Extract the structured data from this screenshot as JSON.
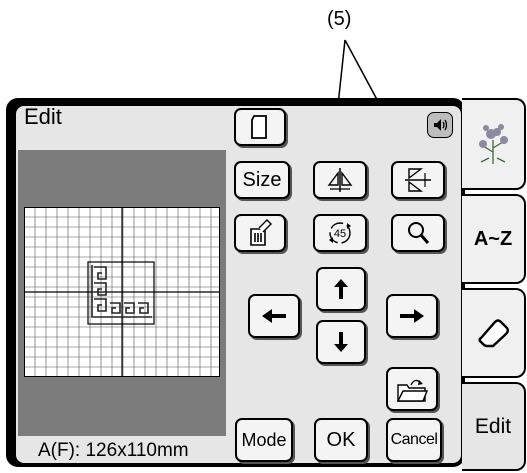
{
  "callout": {
    "label": "(5)"
  },
  "screen": {
    "title": "Edit",
    "size_readout": "A(F): 126x110mm"
  },
  "buttons": {
    "size": "Size",
    "mode": "Mode",
    "ok": "OK",
    "cancel": "Cancel"
  },
  "sidebar": {
    "tabs": [
      {
        "icon": "flower-pattern-icon"
      },
      {
        "label": "A~Z"
      },
      {
        "icon": "eraser-icon"
      },
      {
        "label": "Edit"
      }
    ]
  },
  "icons": [
    "new-page-icon",
    "sound-icon",
    "mirror-horizontal-icon",
    "flip-vertical-icon",
    "delete-icon",
    "rotate-45-icon",
    "zoom-icon",
    "arrow-up-icon",
    "arrow-down-icon",
    "arrow-left-icon",
    "arrow-right-icon",
    "open-folder-icon"
  ]
}
